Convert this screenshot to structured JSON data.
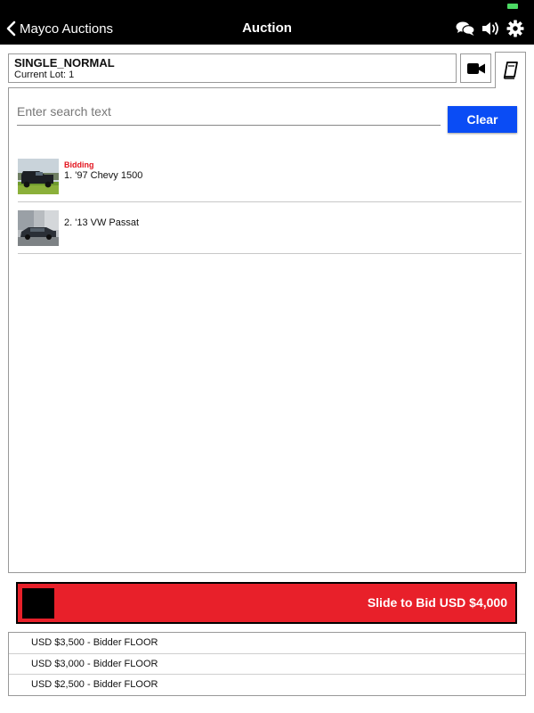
{
  "nav": {
    "back_label": "Mayco Auctions",
    "title": "Auction",
    "icons": [
      "chat-icon",
      "volume-icon",
      "gear-icon"
    ]
  },
  "status_bar": {
    "battery_color": "#4cd964"
  },
  "auction": {
    "name": "SINGLE_NORMAL",
    "current_lot": "Current Lot: 1"
  },
  "search": {
    "placeholder": "Enter search text",
    "value": "",
    "clear_label": "Clear"
  },
  "lots": [
    {
      "status": "Bidding",
      "title": "1. '97 Chevy 1500"
    },
    {
      "status": "",
      "title": "2. '13 VW Passat"
    }
  ],
  "bid_slider": {
    "label": "Slide to Bid USD $4,000",
    "color": "#e8202a"
  },
  "bid_history": [
    "USD $3,500 - Bidder FLOOR",
    "USD $3,000 - Bidder FLOOR",
    "USD $2,500 - Bidder FLOOR"
  ],
  "colors": {
    "accent_button": "#0a4cf5",
    "bidding_status": "#e3141e",
    "navbar": "#000000"
  }
}
